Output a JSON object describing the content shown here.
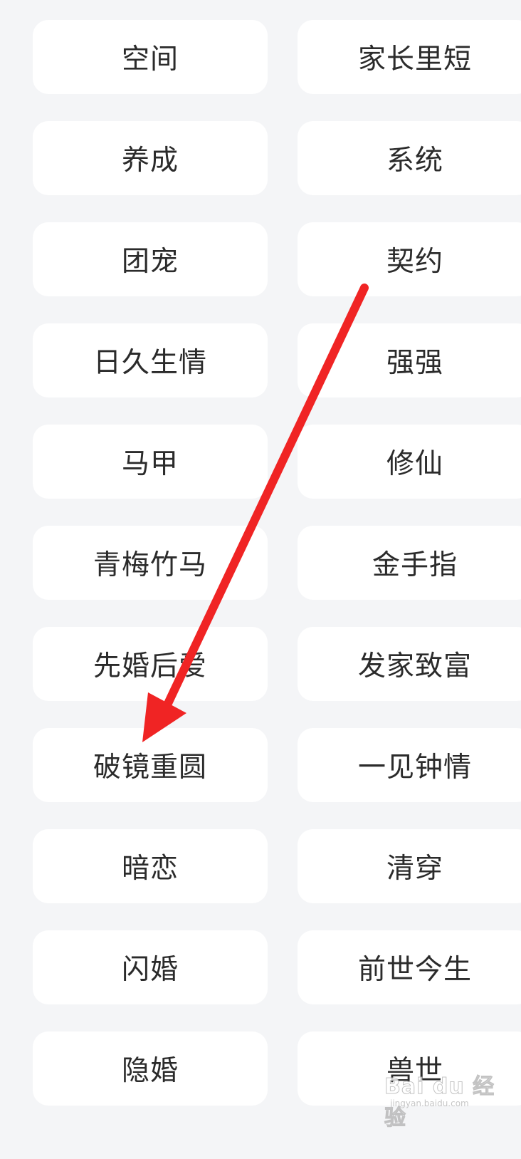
{
  "tags": {
    "left": [
      "空间",
      "养成",
      "团宠",
      "日久生情",
      "马甲",
      "青梅竹马",
      "先婚后爱",
      "破镜重圆",
      "暗恋",
      "闪婚",
      "隐婚"
    ],
    "right": [
      "家长里短",
      "系统",
      "契约",
      "强强",
      "修仙",
      "金手指",
      "发家致富",
      "一见钟情",
      "清穿",
      "前世今生",
      "兽世"
    ]
  },
  "annotation": {
    "arrow_color": "#f02424",
    "arrow_icon": "red-arrow-annotation"
  },
  "watermark": {
    "main": "Bai du 经验",
    "sub": "jingyan.baidu.com"
  },
  "colors": {
    "background": "#f4f5f7",
    "tag_background": "#ffffff",
    "tag_text": "#2b2b2b"
  }
}
